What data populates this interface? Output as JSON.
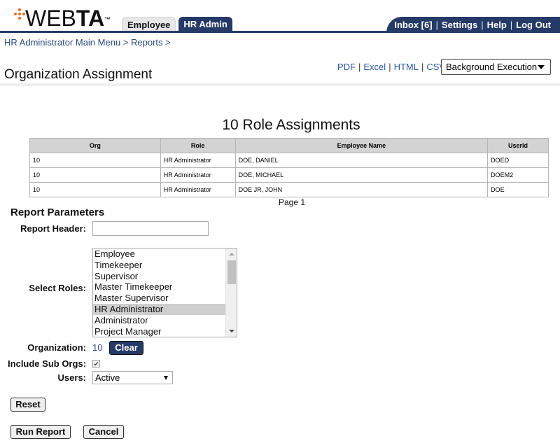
{
  "brand": {
    "logo_light": "WEB",
    "logo_bold": "TA",
    "trademark": "™",
    "accent_color": "#f26b21",
    "nav_color": "#253a66"
  },
  "tabs": [
    {
      "label": "Employee",
      "active": false
    },
    {
      "label": "HR Admin",
      "active": true
    }
  ],
  "top_nav": {
    "inbox": "Inbox [6]",
    "settings": "Settings",
    "help": "Help",
    "logout": "Log Out",
    "separator": "|"
  },
  "breadcrumb": {
    "main_menu": "HR Administrator Main Menu",
    "reports": "Reports",
    "separator": ">"
  },
  "page_title": "Organization Assignment",
  "export": {
    "pdf": "PDF",
    "excel": "Excel",
    "html": "HTML",
    "csv": "CSV",
    "separator": "|",
    "execution_mode": "Background Execution"
  },
  "report": {
    "title": "10 Role Assignments",
    "columns": [
      "Org",
      "Role",
      "Employee Name",
      "UserId"
    ],
    "rows": [
      [
        "10",
        "HR Administrator",
        "DOE, DANIEL",
        "DOED"
      ],
      [
        "10",
        "HR Administrator",
        "DOE, MICHAEL",
        "DOEM2"
      ],
      [
        "10",
        "HR Administrator",
        "DOE JR, JOHN",
        "DOE"
      ]
    ],
    "page_label": "Page 1"
  },
  "params": {
    "title": "Report Parameters",
    "report_header_label": "Report Header:",
    "report_header_value": "",
    "select_roles_label": "Select Roles:",
    "roles": [
      "Employee",
      "Timekeeper",
      "Supervisor",
      "Master Timekeeper",
      "Master Supervisor",
      "HR Administrator",
      "Administrator",
      "Project Manager"
    ],
    "selected_role": "HR Administrator",
    "organization_label": "Organization:",
    "organization_value": "10",
    "clear_label": "Clear",
    "include_sub_orgs_label": "Include Sub Orgs:",
    "include_sub_orgs_checked": true,
    "check_glyph": "✔",
    "users_label": "Users:",
    "users_value": "Active"
  },
  "buttons": {
    "reset": "Reset",
    "run_report": "Run Report",
    "cancel": "Cancel"
  }
}
